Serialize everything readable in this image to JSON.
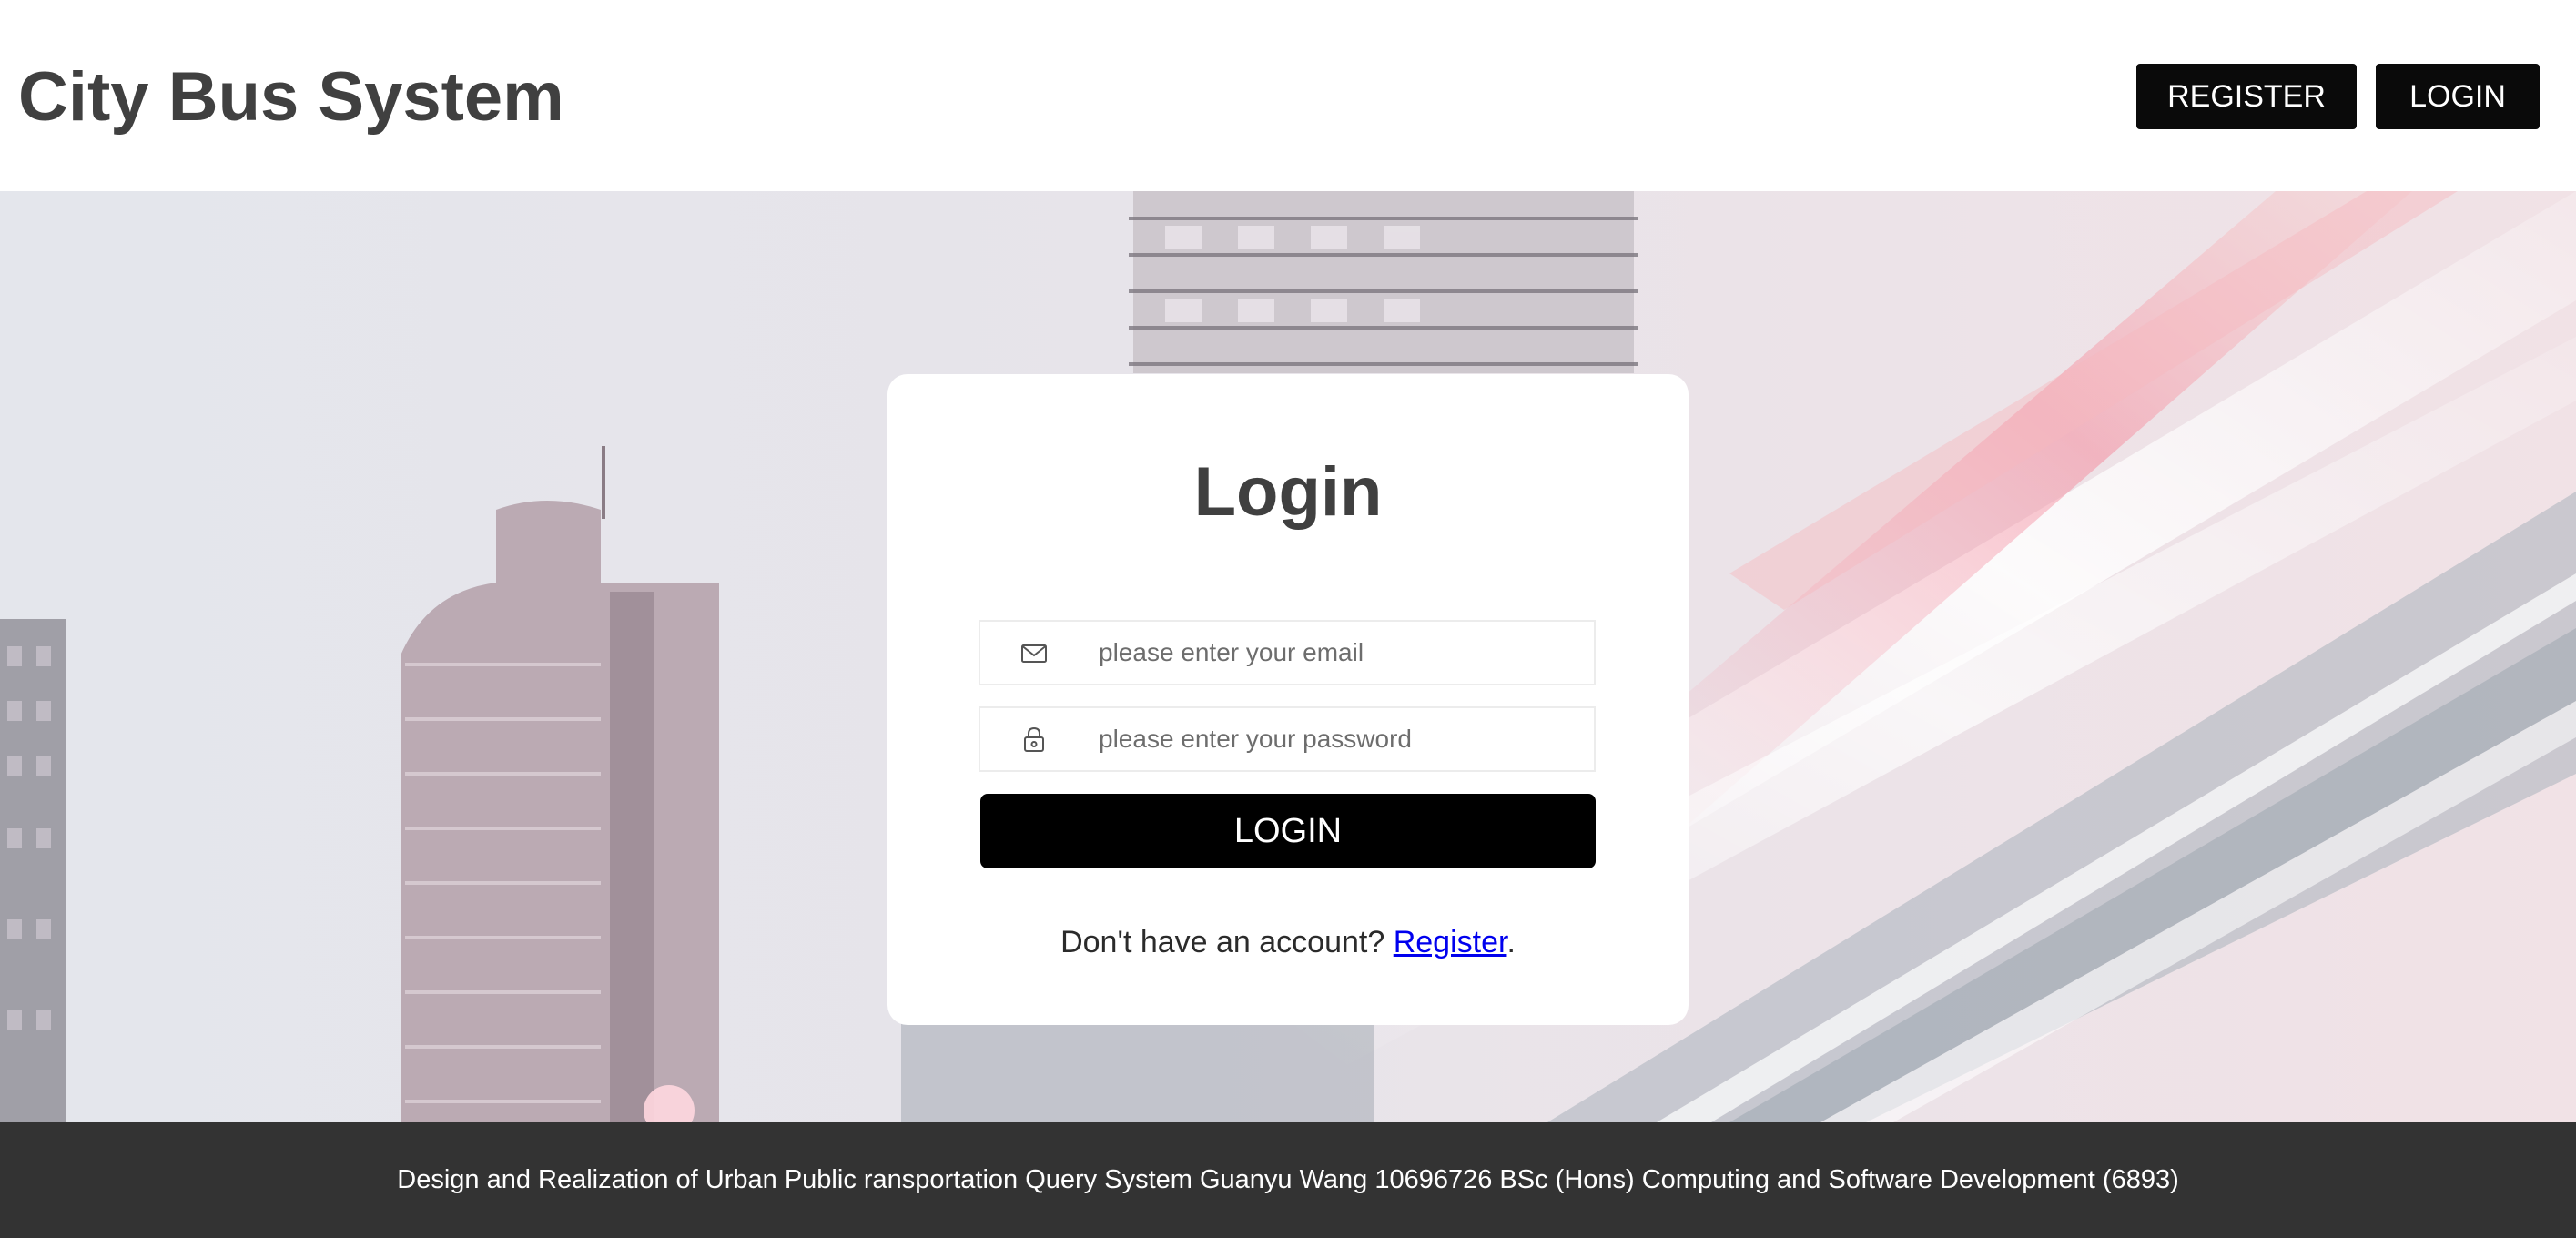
{
  "header": {
    "title": "City Bus System",
    "register_label": "REGISTER",
    "login_label": "LOGIN"
  },
  "login_card": {
    "title": "Login",
    "email": {
      "placeholder": "please enter your email",
      "value": "",
      "icon": "envelope-icon"
    },
    "password": {
      "placeholder": "please enter your password",
      "value": "",
      "icon": "padlock-icon"
    },
    "submit_label": "LOGIN",
    "signup_prompt": "Don't have an account? ",
    "signup_link": "Register",
    "signup_suffix": "."
  },
  "footer": {
    "text": "Design and Realization of Urban Public ransportation Query System Guanyu Wang 10696726 BSc (Hons) Computing and Software Development (6893)"
  },
  "colors": {
    "header_bg": "#ffffff",
    "title_text": "#404040",
    "button_bg": "#0a0a0a",
    "button_text": "#ffffff",
    "link": "#0000ee",
    "footer_bg": "#333333",
    "footer_text": "#ffffff"
  }
}
